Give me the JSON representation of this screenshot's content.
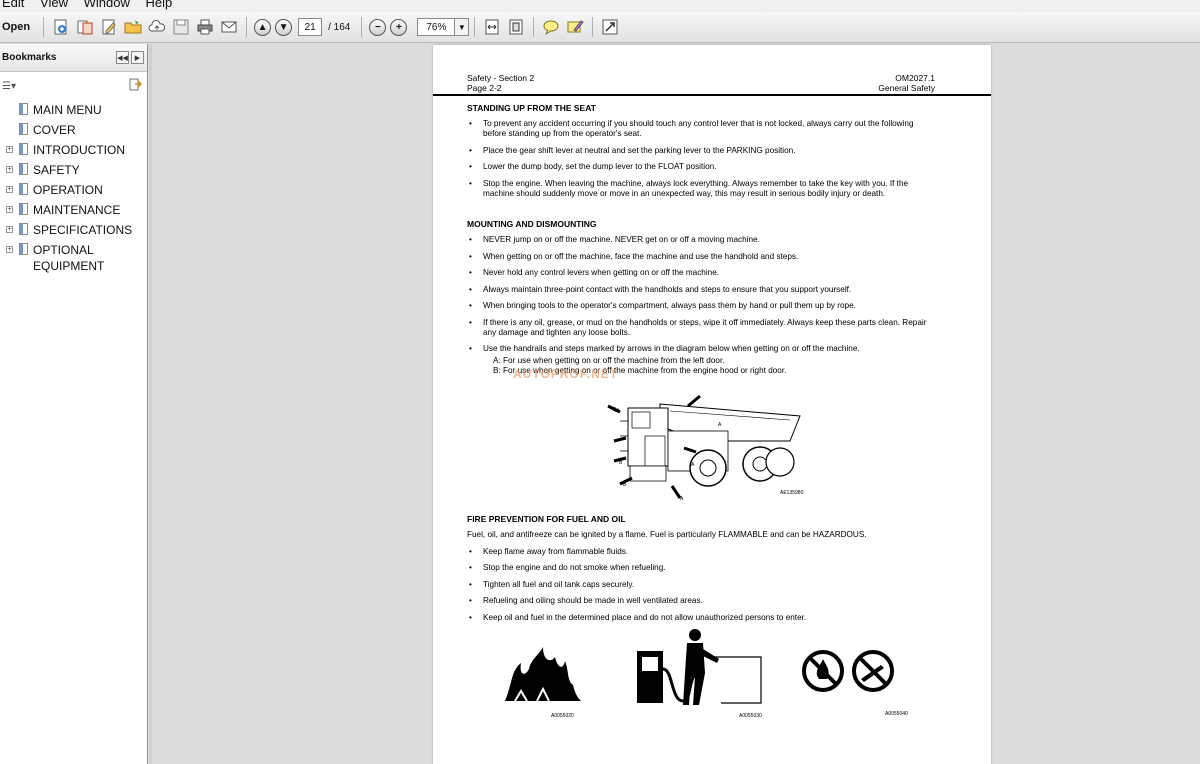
{
  "menubar": {
    "items": [
      "Edit",
      "View",
      "Window",
      "Help"
    ]
  },
  "toolbar": {
    "open_label": "Open",
    "current_page": "21",
    "page_total": "/ 164",
    "zoom": "76%"
  },
  "sidebar": {
    "title": "Bookmarks",
    "items": [
      {
        "label": "MAIN MENU",
        "expandable": false
      },
      {
        "label": "COVER",
        "expandable": false
      },
      {
        "label": "INTRODUCTION",
        "expandable": true
      },
      {
        "label": "SAFETY",
        "expandable": true
      },
      {
        "label": "OPERATION",
        "expandable": true
      },
      {
        "label": "MAINTENANCE",
        "expandable": true
      },
      {
        "label": "SPECIFICATIONS",
        "expandable": true
      },
      {
        "label": "OPTIONAL EQUIPMENT",
        "expandable": true
      }
    ]
  },
  "document": {
    "header_left_1": "Safety - Section 2",
    "header_left_2": "Page 2-2",
    "header_right_1": "OM2027.1",
    "header_right_2": "General Safety",
    "section1": {
      "title": "STANDING UP FROM THE SEAT",
      "bullets": [
        "To prevent any accident occurring if you should touch any control lever that is not locked, always carry out the following before standing up from the operator's seat.",
        "Place the gear shift lever at neutral and set the parking lever to the PARKING position.",
        "Lower the dump body, set the dump lever to the FLOAT position.",
        "Stop the engine. When leaving the machine, always lock everything. Always remember to take the key with you. If the machine should suddenly move or move in an unexpected way, this may result in serious bodily injury or death."
      ]
    },
    "section2": {
      "title": "MOUNTING AND DISMOUNTING",
      "bullets": [
        "NEVER jump on or off the machine. NEVER get on or off a moving machine.",
        "When getting on or off the machine, face the machine and use the handhold and steps.",
        "Never hold any control levers when getting on or off the machine.",
        "Always maintain three-point contact with the handholds and steps to ensure that you support yourself.",
        "When bringing tools to the operator's compartment, always pass them by hand or pull them up by rope.",
        "If there is any oil, grease, or mud on the handholds or steps, wipe it off immediately. Always keep these parts clean. Repair any damage and tighten any loose bolts.",
        "Use the handrails and steps marked by arrows in the diagram below when getting on or off the machine."
      ],
      "sub_a": "A: For use when getting on or off the machine from the left door.",
      "sub_b": "B: For use when getting on or off the machine from the engine hood or right door.",
      "figure_code": "AE135980",
      "label_a": "A",
      "label_b": "B"
    },
    "watermark": "AUTOPROF.NET",
    "section3": {
      "title": "FIRE PREVENTION FOR FUEL AND OIL",
      "intro": "Fuel, oil, and antifreeze can be ignited by a flame. Fuel is particularly FLAMMABLE and can be HAZARDOUS.",
      "bullets": [
        "Keep flame away from flammable fluids.",
        "Stop the engine and do not smoke when refueling.",
        "Tighten all fuel and oil tank caps securely.",
        "Refueling and oiling should be made in well ventilated areas.",
        "Keep oil and fuel in the determined place and do not allow unauthorized persons to enter."
      ],
      "fig_codes": [
        "A0055020",
        "A0055030",
        "A0055040"
      ]
    }
  }
}
